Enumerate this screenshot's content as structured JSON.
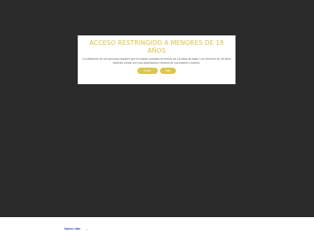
{
  "modal": {
    "title": "ACCESO RESTRINGIDO A MENORES DE 18 AÑOS",
    "text": "La utilización de los servicios requiere que se hayan cumplido al menos los 18 años de edad. Los menores de 18 años deberán contar con una autorización expresa de sus padres o tutores.",
    "enter_label": "Entrar",
    "exit_label": "Salir"
  },
  "footer": {
    "link_label": "Nuevo sitio",
    "arrow": "›"
  },
  "colors": {
    "accent": "#d6c34a",
    "background": "#2b2b2b",
    "link": "#2a3fb0"
  }
}
